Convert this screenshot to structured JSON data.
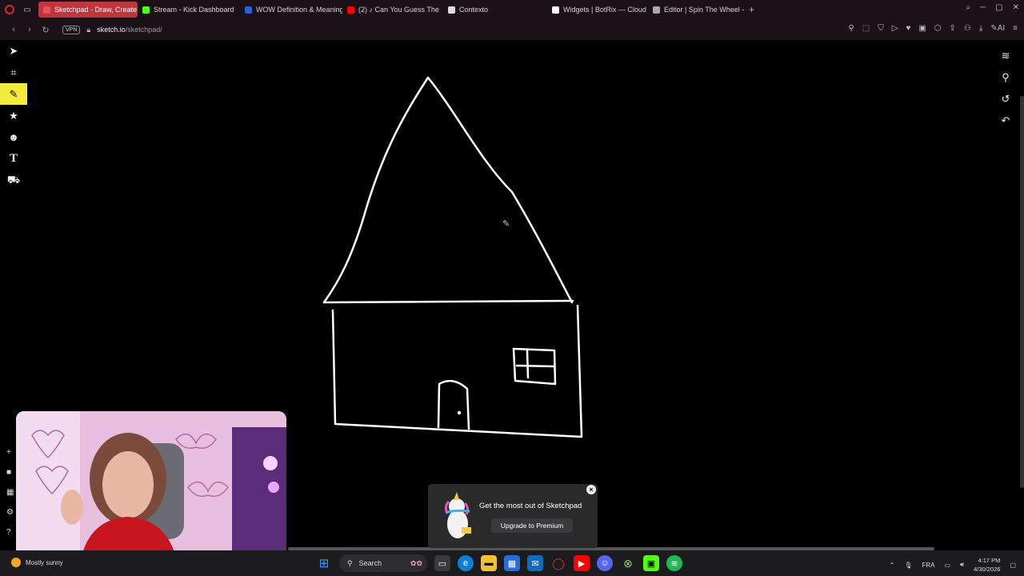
{
  "browser": {
    "tabs": [
      {
        "label": "Sketchpad - Draw, Create",
        "color": "#c0343e",
        "active": true
      },
      {
        "label": "Stream - Kick Dashboard",
        "color": "#53fc18"
      },
      {
        "label": "WOW Definition & Meaning",
        "color": "#2f5fd0"
      },
      {
        "label": "(2) ♪ Can You Guess The",
        "color": "#ff0000"
      },
      {
        "label": "Contexto",
        "color": "#dddddd"
      },
      {
        "label": "Widgets | BotRix — Cloud",
        "color": "#ffffff"
      },
      {
        "label": "Editor | Spin The Wheel -",
        "color": "#aaaaaa"
      }
    ],
    "vpn_label": "VPN",
    "url_host": "sketch.io",
    "url_path": "/sketchpad/",
    "ai_label": "AI"
  },
  "canvas": {
    "stroke_color": "#ffffff",
    "background": "#000000"
  },
  "premium_popup": {
    "title": "Get the most out of Sketchpad",
    "button": "Upgrade to Premium"
  },
  "taskbar": {
    "weather": "Mostly sunny",
    "search_placeholder": "Search",
    "language": "FRA",
    "time": "4:17 PM",
    "date": "4/30/2026"
  },
  "accent": "#f4ec3c"
}
